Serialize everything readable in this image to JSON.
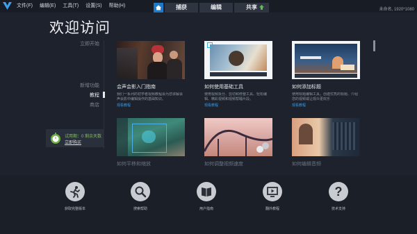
{
  "menu": {
    "items": [
      "文件(F)",
      "编辑(E)",
      "工具(T)",
      "设置(S)",
      "帮助(H)"
    ]
  },
  "tabs": {
    "capture": "捕获",
    "edit": "编辑",
    "share": "共享"
  },
  "project_info": "未命名, 1920*1080",
  "page_title": "欢迎访问",
  "nav": {
    "items": [
      "立即开始",
      "新增功能",
      "教程",
      "商店"
    ],
    "active": "教程"
  },
  "trial": {
    "text": "试用期：0 剩余天数",
    "link": "立即购买"
  },
  "cards": [
    {
      "title": "会声会影入门指南",
      "desc": "我们一系列的初学者视频教程会为您讲解会声会影中编辑操作的基础知识。",
      "link": "观看教程"
    },
    {
      "title": "如何使用基础工具",
      "desc": "使用视频拆分、剪切和修整工具、轻松编辑、精彩视频和视频帮睡片段。",
      "link": "观看教程"
    },
    {
      "title": "如何添加标题",
      "desc": "使用标题编辑工具，创建优秀的标题、介绍您的视频或让观众更欢乐",
      "link": "观看教程"
    },
    {
      "title": "如何平移和缩放",
      "desc": "",
      "link": ""
    },
    {
      "title": "如何调整视频速度",
      "desc": "",
      "link": ""
    },
    {
      "title": "如何编辑音频",
      "desc": "",
      "link": ""
    }
  ],
  "bottom": [
    {
      "label": "获取完整版本",
      "icon": "running-person-icon"
    },
    {
      "label": "搜索帮助",
      "icon": "magnifier-icon"
    },
    {
      "label": "用户指南",
      "icon": "book-icon"
    },
    {
      "label": "翻外教程",
      "icon": "monitor-icon"
    },
    {
      "label": "技术支持",
      "icon": "question-icon"
    }
  ],
  "colors": {
    "accent": "#1e7ac9",
    "link": "#3a9ae8",
    "background": "#1d222c",
    "trial_text": "#7fbf5a"
  }
}
